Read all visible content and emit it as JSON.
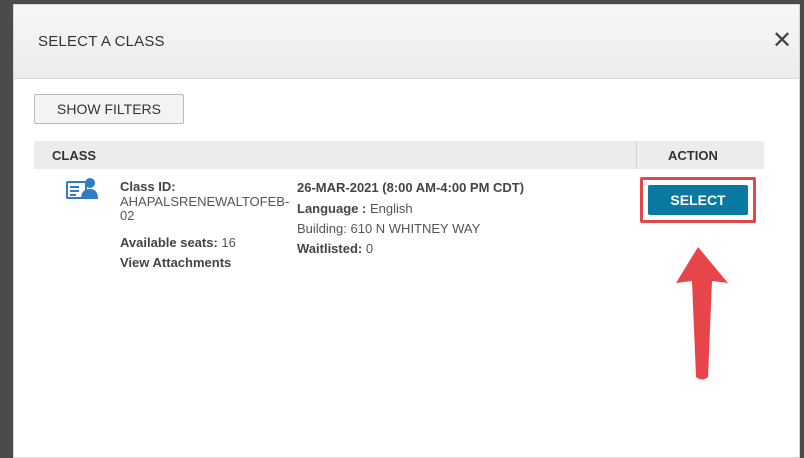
{
  "dialog": {
    "title": "SELECT A CLASS",
    "close_symbol": "✕"
  },
  "filters": {
    "show_filters_label": "SHOW FILTERS"
  },
  "table": {
    "headers": {
      "class": "CLASS",
      "action": "ACTION"
    },
    "rows": [
      {
        "icon": "class-roster-icon",
        "class_id_label": "Class ID:",
        "class_id_value_line1": "AHAPALSRENEWALTOFEB-",
        "class_id_value_line2": "02",
        "available_seats_label": "Available seats:",
        "available_seats_value": "16",
        "view_attachments": "View Attachments",
        "date": "26-MAR-2021 (8:00 AM-4:00 PM CDT)",
        "language_label": "Language :",
        "language_value": "English",
        "building": "Building: 610 N WHITNEY WAY",
        "waitlisted_label": "Waitlisted:",
        "waitlisted_value": "0",
        "action_label": "SELECT"
      }
    ]
  },
  "colors": {
    "select_button": "#0a7aa3",
    "highlight": "#e2474b",
    "icon_blue": "#2f7cc4"
  }
}
